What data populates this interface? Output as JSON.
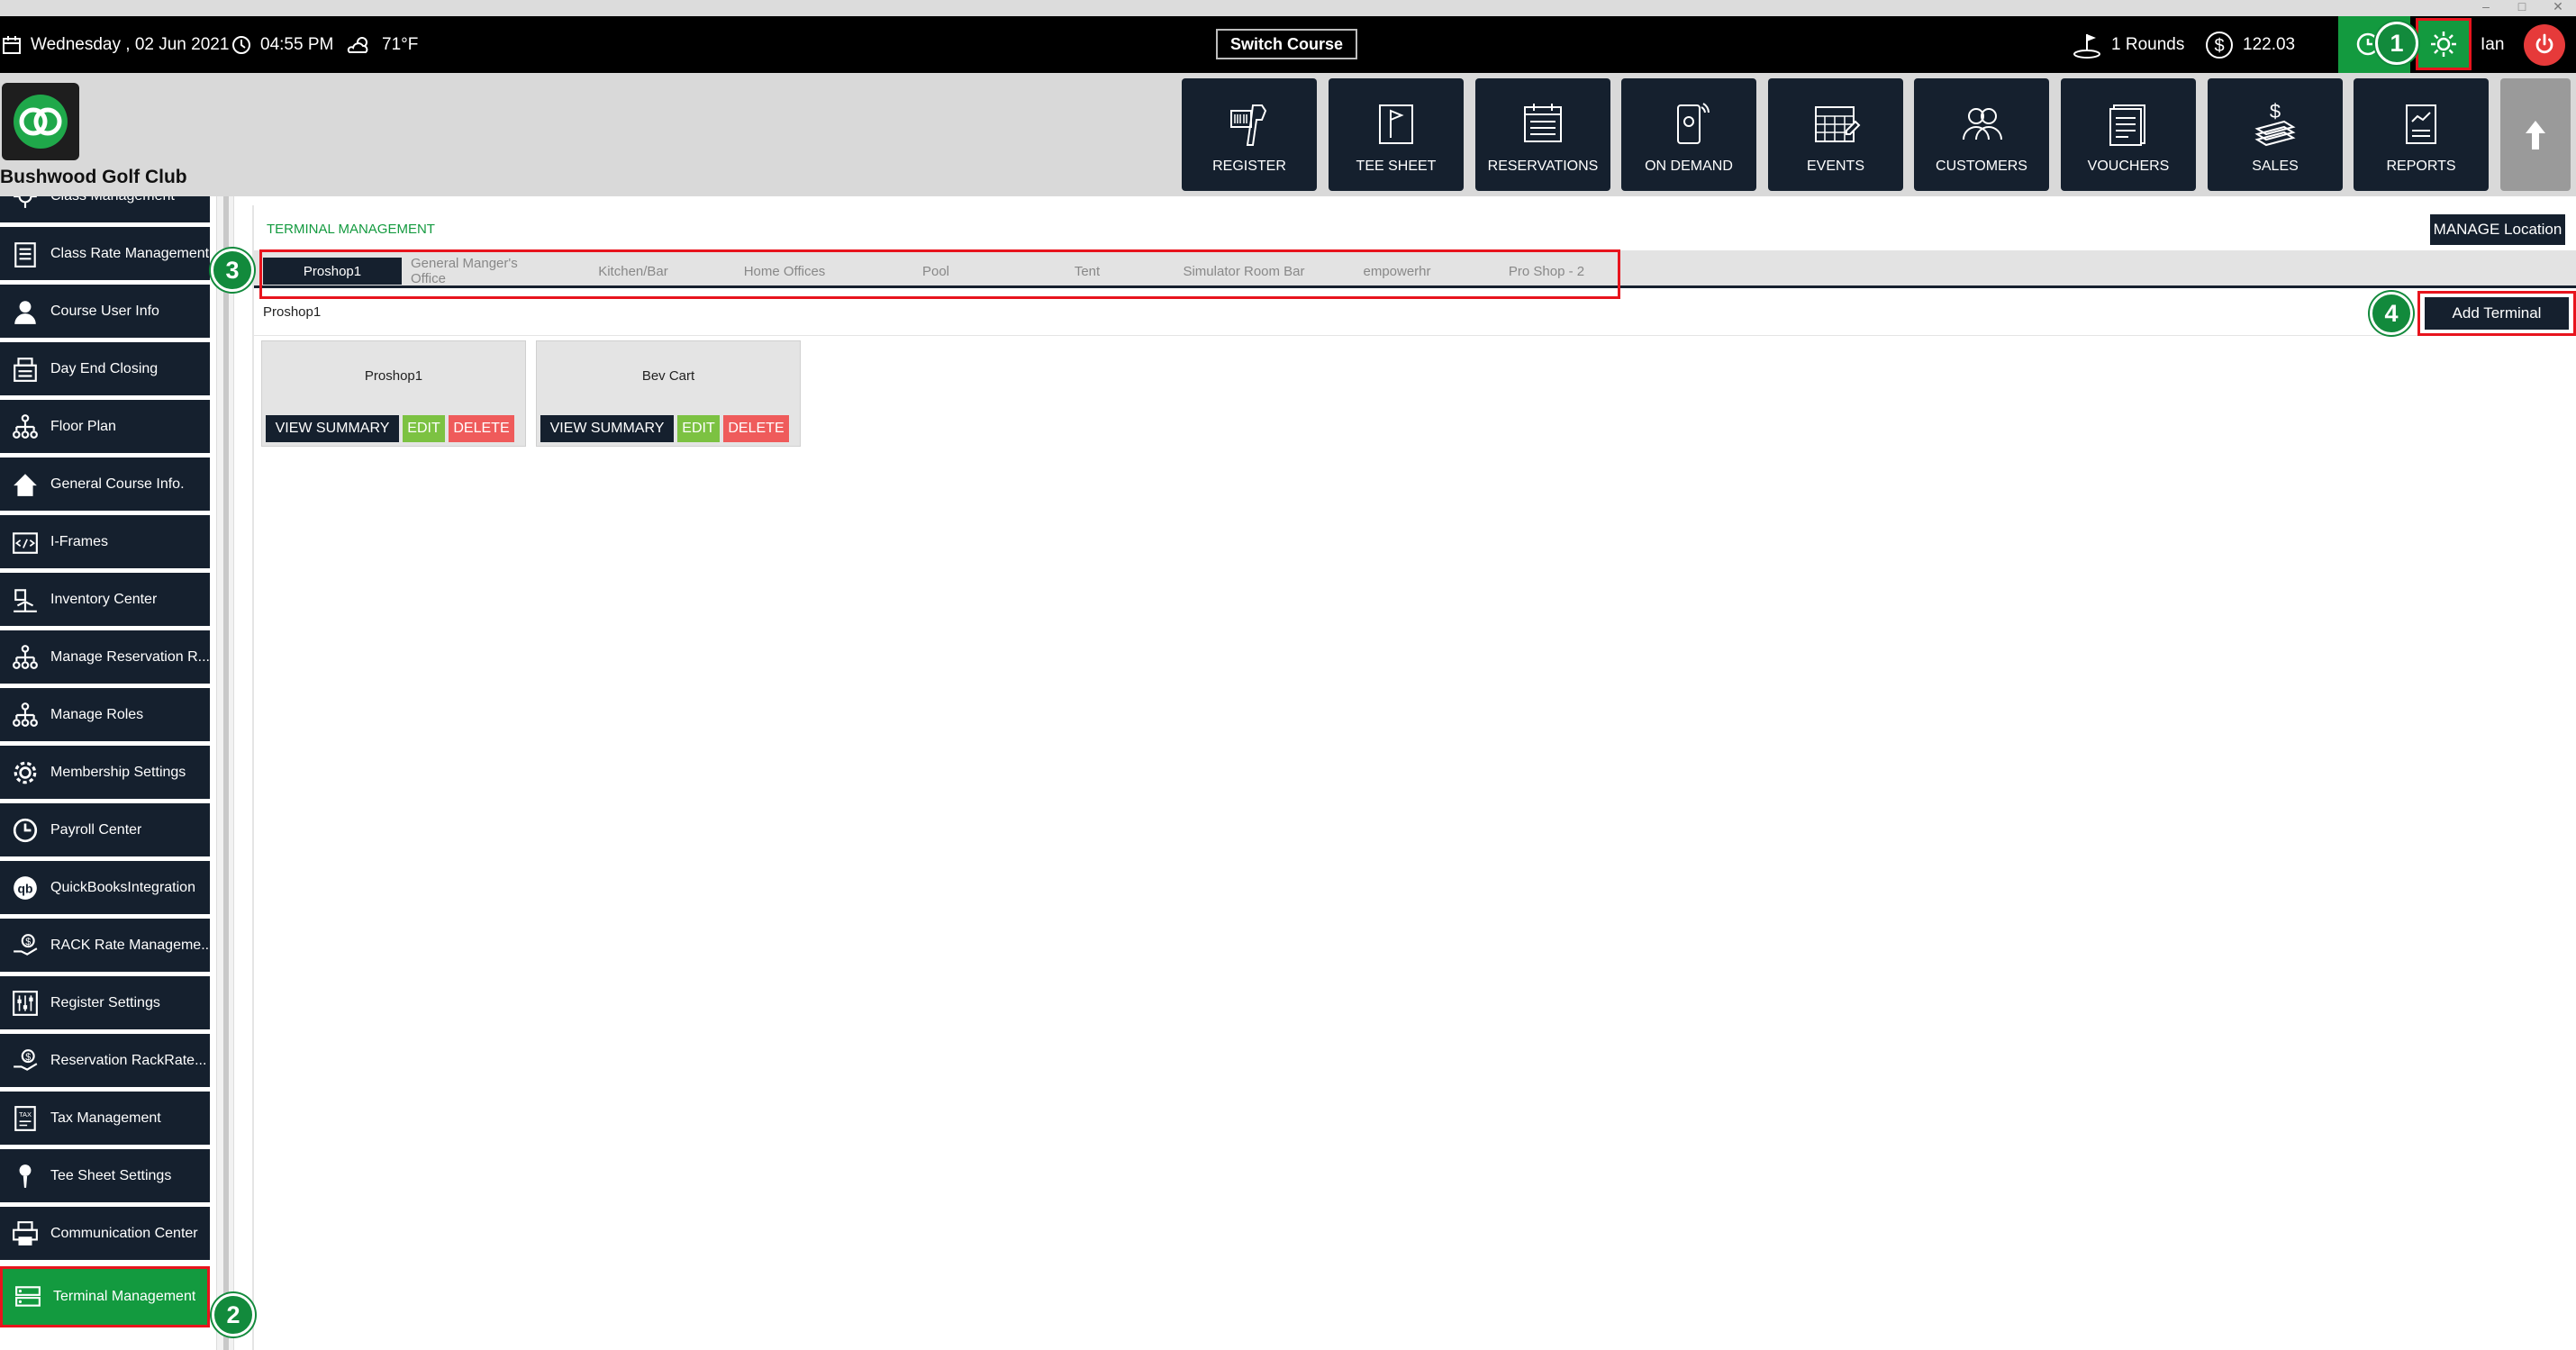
{
  "topbar": {
    "date": "Wednesday ,  02 Jun 2021",
    "time": "04:55 PM",
    "weather": "71°F",
    "switch_course": "Switch Course",
    "rounds": "1 Rounds",
    "amount": "122.03",
    "user": "Ian"
  },
  "header": {
    "club_name": "Bushwood Golf Club",
    "nav": [
      {
        "label": "REGISTER",
        "icon": "barcode-scanner-icon"
      },
      {
        "label": "TEE SHEET",
        "icon": "flag-sheet-icon"
      },
      {
        "label": "RESERVATIONS",
        "icon": "calendar-list-icon"
      },
      {
        "label": "ON DEMAND",
        "icon": "mobile-icon"
      },
      {
        "label": "EVENTS",
        "icon": "calendar-grid-icon"
      },
      {
        "label": "CUSTOMERS",
        "icon": "users-icon"
      },
      {
        "label": "VOUCHERS",
        "icon": "voucher-icon"
      },
      {
        "label": "SALES",
        "icon": "money-icon"
      },
      {
        "label": "REPORTS",
        "icon": "report-icon"
      }
    ]
  },
  "sidebar": {
    "items": [
      {
        "label": "Class Management",
        "icon": "gear-user-icon"
      },
      {
        "label": "Class Rate Management",
        "icon": "list-icon"
      },
      {
        "label": "Course User Info",
        "icon": "user-icon"
      },
      {
        "label": "Day End Closing",
        "icon": "register-icon"
      },
      {
        "label": "Floor Plan",
        "icon": "hierarchy-icon"
      },
      {
        "label": "General Course Info.",
        "icon": "home-icon"
      },
      {
        "label": "I-Frames",
        "icon": "code-icon"
      },
      {
        "label": "Inventory Center",
        "icon": "inventory-icon"
      },
      {
        "label": "Manage Reservation R...",
        "icon": "hierarchy-icon"
      },
      {
        "label": "Manage Roles",
        "icon": "hierarchy-icon"
      },
      {
        "label": "Membership Settings",
        "icon": "gear-icon"
      },
      {
        "label": "Payroll Center",
        "icon": "clock-icon"
      },
      {
        "label": "QuickBooksIntegration",
        "icon": "quickbooks-icon"
      },
      {
        "label": "RACK Rate Manageme...",
        "icon": "hand-money-icon"
      },
      {
        "label": "Register Settings",
        "icon": "sliders-icon"
      },
      {
        "label": "Reservation RackRate...",
        "icon": "hand-money-icon"
      },
      {
        "label": "Tax Management",
        "icon": "tax-icon"
      },
      {
        "label": "Tee Sheet Settings",
        "icon": "golf-tee-icon"
      },
      {
        "label": "Communication Center",
        "icon": "printer-icon"
      },
      {
        "label": "Terminal Management",
        "icon": "terminal-icon"
      }
    ]
  },
  "main": {
    "breadcrumb": "TERMINAL MANAGEMENT",
    "manage_location": "MANAGE Location",
    "tabs": [
      "Proshop1",
      "General Manger's Office",
      "Kitchen/Bar",
      "Home Offices",
      "Pool",
      "Tent",
      "Simulator Room Bar",
      "empowerhr",
      "Pro Shop - 2"
    ],
    "selected_location": "Proshop1",
    "add_terminal": "Add Terminal",
    "terminals": [
      {
        "name": "Proshop1",
        "view": "VIEW SUMMARY",
        "edit": "EDIT",
        "delete": "DELETE"
      },
      {
        "name": "Bev Cart",
        "view": "VIEW SUMMARY",
        "edit": "EDIT",
        "delete": "DELETE"
      }
    ]
  },
  "badges": [
    "1",
    "2",
    "3",
    "4"
  ],
  "colors": {
    "navy": "#15202e",
    "green": "#139a3f",
    "highlight_red": "#e8141d",
    "edit_green": "#7cc242",
    "delete_red": "#ef5b5b"
  }
}
